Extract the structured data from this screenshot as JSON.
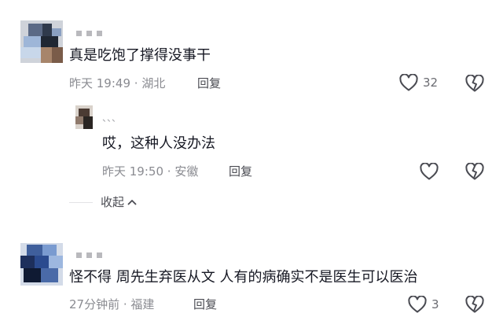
{
  "comments": [
    {
      "text": "真是吃饱了撑得没事干",
      "time": "昨天 19:49",
      "location": "湖北",
      "reply_label": "回复",
      "like_count": "32",
      "replies": [
        {
          "username": "、、、",
          "text": "哎，这种人没办法",
          "time": "昨天 19:50",
          "location": "安徽",
          "reply_label": "回复"
        }
      ],
      "collapse_label": "收起"
    },
    {
      "text": "怪不得 周先生弃医从文  人有的病确实不是医生可以医治",
      "time": "27分钟前",
      "location": "福建",
      "reply_label": "回复",
      "like_count": "3"
    }
  ],
  "icons": {
    "like": "heart-outline-icon",
    "dislike": "broken-heart-icon",
    "collapse": "chevron-up-icon"
  },
  "colors": {
    "text": "#161823",
    "meta": "#8a8b91",
    "icon": "#4a4b52"
  }
}
